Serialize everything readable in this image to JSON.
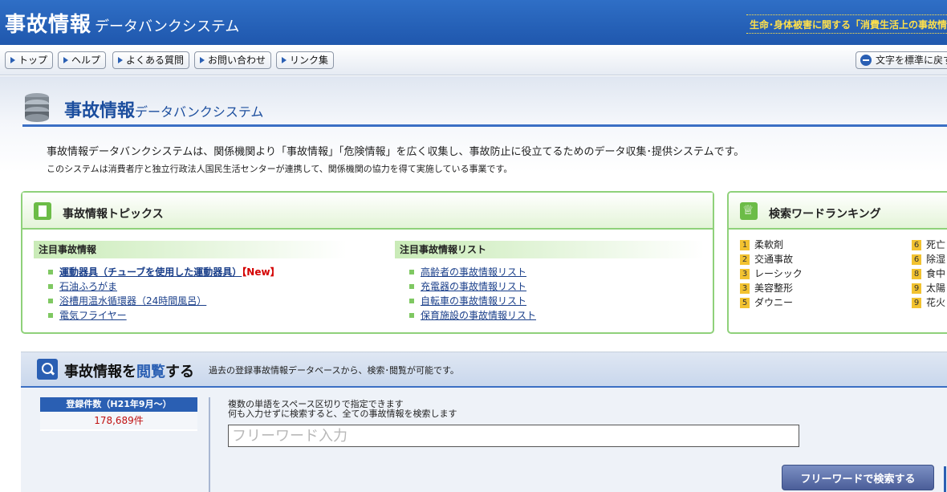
{
  "header": {
    "brand_main": "事故情報",
    "brand_sub": "データバンクシステム",
    "tagline": "生命･身体被害に関する「消費生活上の事故情報」を"
  },
  "nav": {
    "items": [
      {
        "label": "トップ"
      },
      {
        "label": "ヘルプ"
      },
      {
        "label": "よくある質問"
      },
      {
        "label": "お問い合わせ"
      },
      {
        "label": "リンク集"
      }
    ],
    "text_size_label": "文字を標準に戻す"
  },
  "page": {
    "title_main": "事故情報",
    "title_sub": "データバンクシステム",
    "intro1": "事故情報データバンクシステムは、関係機関より「事故情報」「危険情報」を広く収集し、事故防止に役立てるためのデータ収集･提供システムです。",
    "intro2": "このシステムは消費者庁と独立行政法人国民生活センターが連携して、関係機関の協力を得て実施している事業です。"
  },
  "topics": {
    "title": "事故情報トピックス",
    "featured_heading": "注目事故情報",
    "featured": [
      {
        "label": "運動器具（チューブを使用した運動器具）",
        "badge": "【New】"
      },
      {
        "label": "石油ふろがま"
      },
      {
        "label": "浴槽用温水循環器（24時間風呂）"
      },
      {
        "label": "電気フライヤー"
      }
    ],
    "list_heading": "注目事故情報リスト",
    "lists": [
      {
        "label": "高齢者の事故情報リスト"
      },
      {
        "label": "充電器の事故情報リスト"
      },
      {
        "label": "自転車の事故情報リスト"
      },
      {
        "label": "保育施設の事故情報リスト"
      }
    ]
  },
  "ranking": {
    "title": "検索ワードランキング",
    "left": [
      {
        "rank": "1",
        "word": "柔軟剤"
      },
      {
        "rank": "2",
        "word": "交通事故"
      },
      {
        "rank": "3",
        "word": "レーシック"
      },
      {
        "rank": "3",
        "word": "美容整形"
      },
      {
        "rank": "5",
        "word": "ダウニー"
      }
    ],
    "right": [
      {
        "rank": "6",
        "word": "死亡"
      },
      {
        "rank": "6",
        "word": "除湿"
      },
      {
        "rank": "8",
        "word": "食中"
      },
      {
        "rank": "9",
        "word": "太陽"
      },
      {
        "rank": "9",
        "word": "花火"
      }
    ],
    "badge_color": "#f2c230"
  },
  "browse": {
    "title_a": "事故情報を",
    "title_b": "閲覧",
    "title_c": "する",
    "desc": "過去の登録事故情報データベースから、検索･閲覧が可能です。",
    "count_label": "登録件数（H21年9月〜）",
    "count_value": "178,689件",
    "hint1": "複数の単語をスペース区切りで指定できます",
    "hint2": "何も入力せずに検索すると、全ての事故情報を検索します",
    "freeword_placeholder": "フリーワード入力",
    "search_button": "フリーワードで検索する"
  },
  "colors": {
    "header_blue": "#2f6fc6",
    "tagline_yellow": "#ffe04a",
    "green_border": "#8fd17a",
    "link_blue": "#1a3f8a",
    "new_red": "#d40000"
  }
}
